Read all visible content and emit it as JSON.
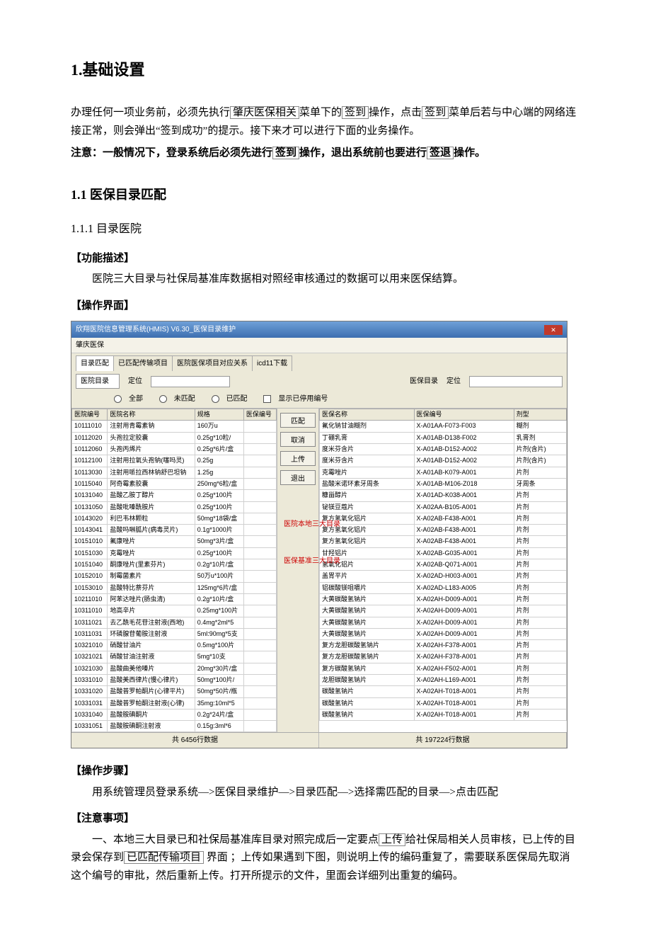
{
  "h1": "1.基础设置",
  "intro": {
    "p1a": "办理任何一项业务前，必须先执行",
    "p1b": "肇庆医保相关",
    "p1c": "菜单下的",
    "p1d": "签到",
    "p1e": "操作，点击",
    "p1f": "签到",
    "p1g": "菜单后若与中心端的网络连接正常，则会弹出“签到成功”的提示。接下来才可以进行下面的业务操作。",
    "p2a": "注意：一般情况下，登录系统后必须先进行",
    "p2b": "签到",
    "p2c": "操作，退出系统前也要进行",
    "p2d": "签退",
    "p2e": "操作。"
  },
  "h2": "1.1 医保目录匹配",
  "h3": "1.1.1 目录医院",
  "sec_func_label": "【功能描述】",
  "sec_func_text": "医院三大目录与社保局基准库数据相对照经审核通过的数据可以用来医保结算。",
  "sec_ui_label": "【操作界面】",
  "sec_steps_label": "【操作步骤】",
  "sec_steps_text": "用系统管理员登录系统—>医保目录维护—>目录匹配—>选择需匹配的目录—>点击匹配",
  "sec_note_label": "【注意事项】",
  "note": {
    "a": "一、本地三大目录已和社保局基准库目录对照完成后一定要点",
    "b": "上传",
    "c": "给社保局相关人员审核，已上传的目录会保存到",
    "d": "已匹配传输项目",
    "e": " 界面 ；上传如果遇到下图，则说明上传的编码重复了，需要联系医保局先取消这个编号的审批，然后重新上传。打开所提示的文件，里面会详细列出重复的编码。"
  },
  "shot": {
    "title": "欣翔医院信息管理系统(HMIS) V6.30_医保目录维护",
    "menu": "肇庆医保",
    "tabs": [
      "目录匹配",
      "已匹配传输项目",
      "医院医保项目对应关系",
      "icd11下载"
    ],
    "left_dd": "医院目录",
    "locate": "定位",
    "right_lbl": "医保目录",
    "filters": [
      "全部",
      "未匹配",
      "已匹配",
      "显示已停用编号"
    ],
    "btns": [
      "匹配",
      "取消",
      "上传",
      "退出"
    ],
    "left_cols": [
      "医院编号",
      "医院名称",
      "规格",
      "医保编号"
    ],
    "right_cols": [
      "医保名称",
      "医保编号",
      "剂型"
    ],
    "left_rows": [
      [
        "10111010",
        "注射用青霉素钠",
        "160万u",
        ""
      ],
      [
        "10112020",
        "头孢拉定胶囊",
        "0.25g*10粒/",
        ""
      ],
      [
        "10112060",
        "头孢丙烯片",
        "0.25g*6片/盒",
        ""
      ],
      [
        "10112100",
        "注射用拉氧头孢钠(噻吗灵)",
        "0.25g",
        ""
      ],
      [
        "10113030",
        "注射用哌拉西林钠舒巴坦钠",
        "1.25g",
        ""
      ],
      [
        "10115040",
        "阿奇霉素胶囊",
        "250mg*6粒/盒",
        ""
      ],
      [
        "10131040",
        "盐酸乙胺丁醇片",
        "0.25g*100片",
        ""
      ],
      [
        "10131050",
        "盐酸吡嗪酰胺片",
        "0.25g*100片",
        ""
      ],
      [
        "10143020",
        "利巴韦林颗粒",
        "50mg*18袋/盒",
        ""
      ],
      [
        "10143041",
        "盐酸吗啉胍片(病毒灵片)",
        "0.1g*1000片",
        ""
      ],
      [
        "10151010",
        "氟康唑片",
        "50mg*3片/盒",
        ""
      ],
      [
        "10151030",
        "克霉唑片",
        "0.25g*100片",
        ""
      ],
      [
        "10151040",
        "酮康唑片(里素芬片)",
        "0.2g*10片/盒",
        ""
      ],
      [
        "10152010",
        "制霉菌素片",
        "50万u*100片",
        ""
      ],
      [
        "10153010",
        "盐酸特比萘芬片",
        "125mg*6片/盒",
        ""
      ],
      [
        "10211010",
        "阿苯达唑片(肠虫清)",
        "0.2g*10片/盒",
        ""
      ],
      [
        "10311010",
        "地高辛片",
        "0.25mg*100片",
        ""
      ],
      [
        "10311021",
        "去乙酰毛花苷注射液(西地)",
        "0.4mg*2ml*5",
        ""
      ],
      [
        "10311031",
        "环磷腺苷葡胺注射液",
        "5ml:90mg*5支",
        ""
      ],
      [
        "10321010",
        "硝酸甘油片",
        "0.5mg*100片",
        ""
      ],
      [
        "10321021",
        "硝酸甘油注射液",
        "5mg*10支",
        ""
      ],
      [
        "10321030",
        "盐酸曲美他嗪片",
        "20mg*30片/盒",
        ""
      ],
      [
        "10331010",
        "盐酸美西律片(慢心律片)",
        "50mg*100片/",
        ""
      ],
      [
        "10331020",
        "盐酸普罗帕酮片(心律平片)",
        "50mg*50片/瓶",
        ""
      ],
      [
        "10331031",
        "盐酸普罗帕酮注射液(心律)",
        "35mg:10ml*5",
        ""
      ],
      [
        "10331040",
        "盐酸胺碘酮片",
        "0.2g*24片/盒",
        ""
      ],
      [
        "10331051",
        "盐酸胺碘酮注射液",
        "0.15g:3ml*6",
        ""
      ]
    ],
    "right_rows": [
      [
        "氟化钠甘油糊剂",
        "X-A01AA-F073-F003",
        "糊剂"
      ],
      [
        "丁硼乳膏",
        "X-A01AB-D138-F002",
        "乳膏剂"
      ],
      [
        "度米芬含片",
        "X-A01AB-D152-A002",
        "片剂(含片)"
      ],
      [
        "度米芬含片",
        "X-A01AB-D152-A002",
        "片剂(含片)"
      ],
      [
        "克霉唑片",
        "X-A01AB-K079-A001",
        "片剂"
      ],
      [
        "盐酸米诺环素牙周条",
        "X-A01AB-M106-Z018",
        "牙周条"
      ],
      [
        "糠甾醇片",
        "X-A01AD-K038-A001",
        "片剂"
      ],
      [
        "铋镁豆蔻片",
        "X-A02AA-B105-A001",
        "片剂"
      ],
      [
        "复方氢氧化铝片",
        "X-A02AB-F438-A001",
        "片剂"
      ],
      [
        "复方氢氧化铝片",
        "X-A02AB-F438-A001",
        "片剂"
      ],
      [
        "复方氢氧化铝片",
        "X-A02AB-F438-A001",
        "片剂"
      ],
      [
        "甘羟铝片",
        "X-A02AB-G035-A001",
        "片剂"
      ],
      [
        "氢氧化铝片",
        "X-A02AB-Q071-A001",
        "片剂"
      ],
      [
        "盖胃平片",
        "X-A02AD-H003-A001",
        "片剂"
      ],
      [
        "铝碳酸镁咀嚼片",
        "X-A02AD-L183-A005",
        "片剂"
      ],
      [
        "大黄碳酸氢钠片",
        "X-A02AH-D009-A001",
        "片剂"
      ],
      [
        "大黄碳酸氢钠片",
        "X-A02AH-D009-A001",
        "片剂"
      ],
      [
        "大黄碳酸氢钠片",
        "X-A02AH-D009-A001",
        "片剂"
      ],
      [
        "大黄碳酸氢钠片",
        "X-A02AH-D009-A001",
        "片剂"
      ],
      [
        "复方龙胆碳酸氢钠片",
        "X-A02AH-F378-A001",
        "片剂"
      ],
      [
        "复方龙胆碳酸氢钠片",
        "X-A02AH-F378-A001",
        "片剂"
      ],
      [
        "复方碳酸氢钠片",
        "X-A02AH-F502-A001",
        "片剂"
      ],
      [
        "龙胆碳酸氢钠片",
        "X-A02AH-L169-A001",
        "片剂"
      ],
      [
        "碳酸氢钠片",
        "X-A02AH-T018-A001",
        "片剂"
      ],
      [
        "碳酸氢钠片",
        "X-A02AH-T018-A001",
        "片剂"
      ],
      [
        "碳酸氢钠片",
        "X-A02AH-T018-A001",
        "片剂"
      ]
    ],
    "footer_left": "共 6456行数据",
    "footer_right": "共 197224行数据",
    "anno1": "医院本地三大目录",
    "anno2": "医保基准三大目录"
  }
}
